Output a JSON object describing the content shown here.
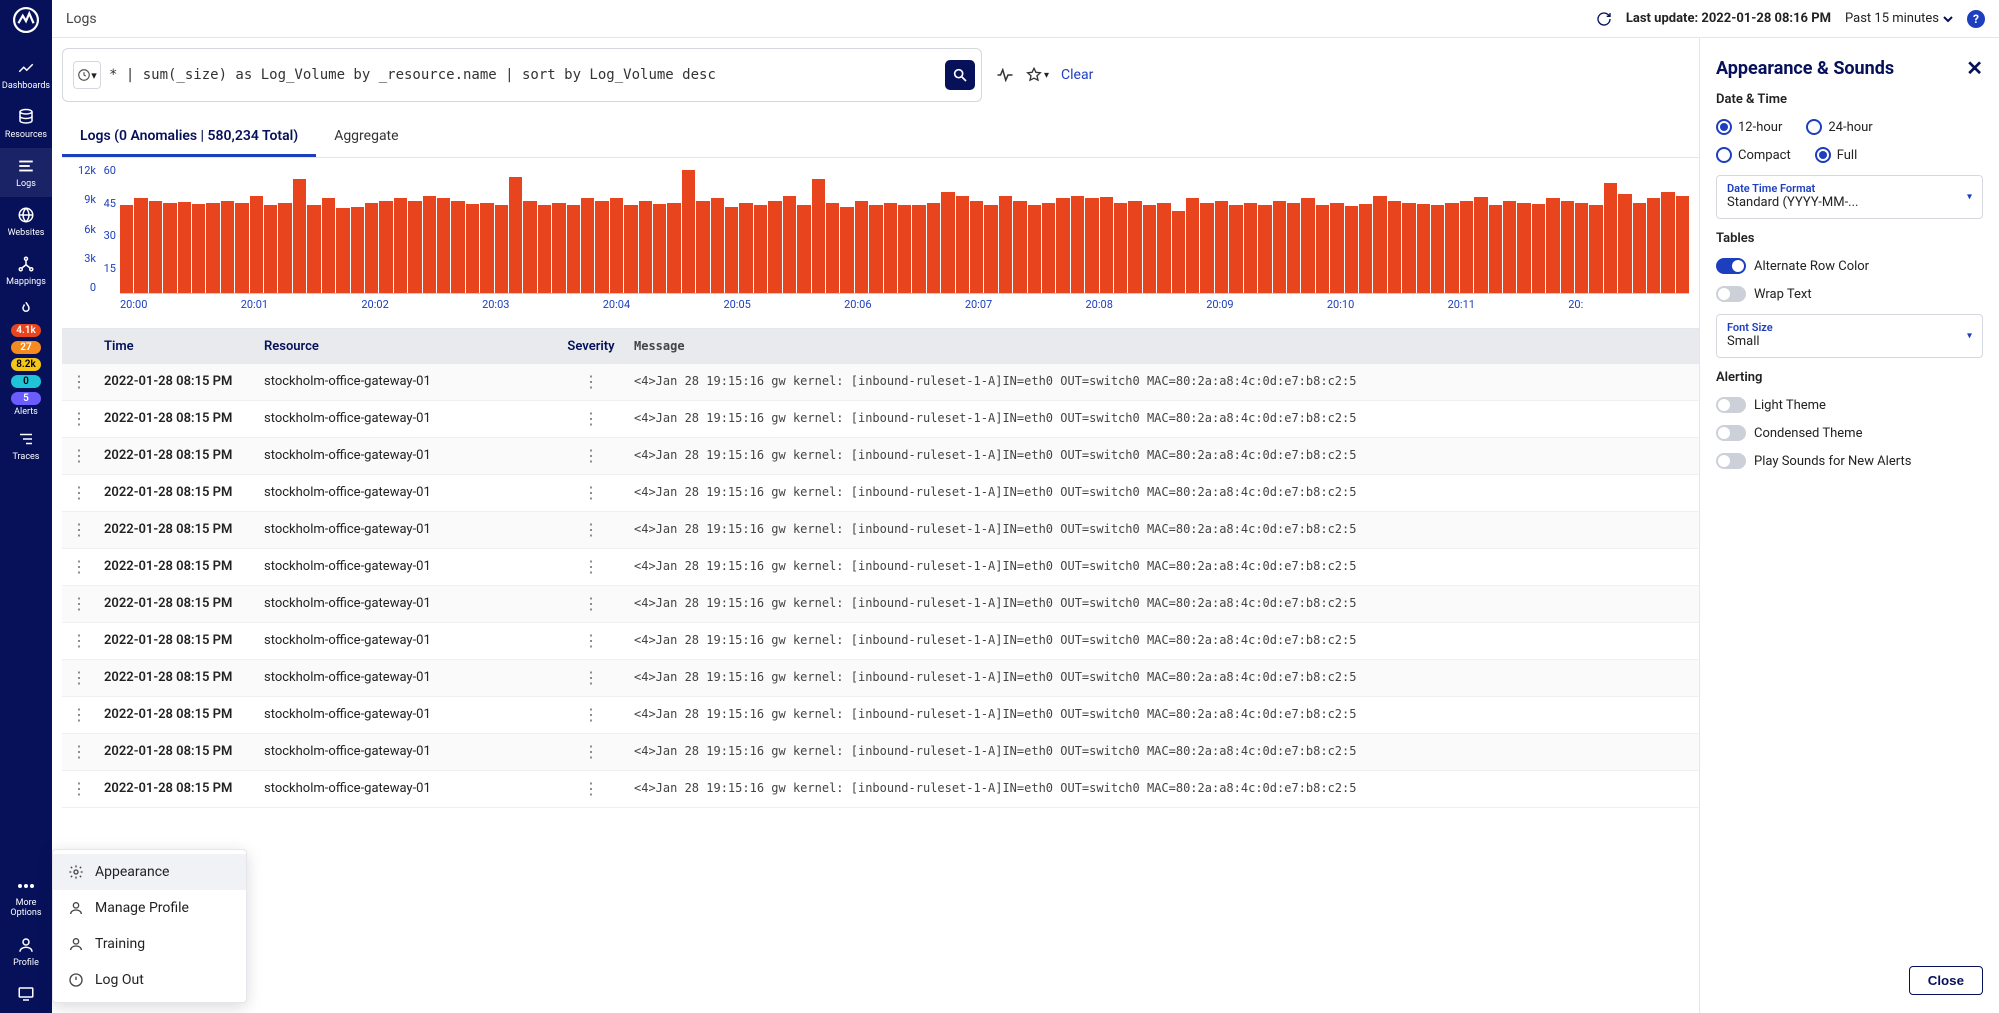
{
  "page_title": "Logs",
  "topbar": {
    "last_update_label": "Last update:",
    "last_update_value": "2022-01-28 08:16 PM",
    "time_range": "Past 15 minutes"
  },
  "sidebar": {
    "items": [
      {
        "label": "Dashboards"
      },
      {
        "label": "Resources"
      },
      {
        "label": "Logs"
      },
      {
        "label": "Websites"
      },
      {
        "label": "Mappings"
      }
    ],
    "alert_badges": [
      "4.1k",
      "27",
      "8.2k",
      "0",
      "5"
    ],
    "alerts_label": "Alerts",
    "traces_label": "Traces",
    "more_label": "More Options",
    "profile_label": "Profile"
  },
  "query": {
    "text": "* | sum(_size) as Log_Volume by _resource.name | sort by Log_Volume desc",
    "clear_label": "Clear"
  },
  "tabs": {
    "logs": "Logs (0 Anomalies | 580,234 Total)",
    "aggregate": "Aggregate"
  },
  "chart_data": {
    "type": "bar",
    "y_ticks_left": [
      "12k",
      "9k",
      "6k",
      "3k",
      "0"
    ],
    "y_ticks_right": [
      "60",
      "45",
      "30",
      "15",
      ""
    ],
    "x_ticks": [
      "20:00",
      "20:01",
      "20:02",
      "20:03",
      "20:04",
      "20:05",
      "20:06",
      "20:07",
      "20:08",
      "20:09",
      "20:10",
      "20:11",
      "20:"
    ],
    "ylim": [
      0,
      12000
    ],
    "values": [
      8.2,
      8.8,
      8.6,
      8.4,
      8.5,
      8.3,
      8.4,
      8.6,
      8.4,
      9.0,
      8.2,
      8.4,
      10.6,
      8.2,
      8.8,
      7.9,
      8.0,
      8.4,
      8.6,
      8.8,
      8.6,
      9.0,
      8.8,
      8.6,
      8.3,
      8.4,
      8.2,
      10.8,
      8.6,
      8.2,
      8.4,
      8.2,
      8.8,
      8.6,
      8.8,
      8.2,
      8.6,
      8.3,
      8.4,
      11.4,
      8.6,
      8.8,
      8.0,
      8.4,
      8.2,
      8.6,
      9.0,
      8.2,
      10.6,
      8.4,
      8.0,
      8.6,
      8.2,
      8.4,
      8.2,
      8.2,
      8.4,
      9.4,
      9.0,
      8.6,
      8.2,
      9.0,
      8.6,
      8.2,
      8.4,
      8.8,
      9.0,
      8.8,
      8.9,
      8.4,
      8.6,
      8.2,
      8.4,
      7.6,
      8.8,
      8.4,
      8.6,
      8.2,
      8.4,
      8.2,
      8.6,
      8.4,
      8.8,
      8.2,
      8.4,
      8.1,
      8.3,
      9.0,
      8.6,
      8.4,
      8.3,
      8.2,
      8.4,
      8.6,
      8.9,
      8.2,
      8.6,
      8.4,
      8.3,
      8.8,
      8.6,
      8.4,
      8.2,
      10.2,
      9.2,
      8.4,
      8.8,
      9.4,
      9.0
    ]
  },
  "table": {
    "headers": {
      "time": "Time",
      "resource": "Resource",
      "severity": "Severity",
      "message": "Message"
    },
    "rows": [
      {
        "time": "2022-01-28 08:15 PM",
        "resource": "stockholm-office-gateway-01",
        "message": "<4>Jan 28 19:15:16 gw kernel: [inbound-ruleset-1-A]IN=eth0 OUT=switch0 MAC=80:2a:a8:4c:0d:e7:b8:c2:5"
      },
      {
        "time": "2022-01-28 08:15 PM",
        "resource": "stockholm-office-gateway-01",
        "message": "<4>Jan 28 19:15:16 gw kernel: [inbound-ruleset-1-A]IN=eth0 OUT=switch0 MAC=80:2a:a8:4c:0d:e7:b8:c2:5"
      },
      {
        "time": "2022-01-28 08:15 PM",
        "resource": "stockholm-office-gateway-01",
        "message": "<4>Jan 28 19:15:16 gw kernel: [inbound-ruleset-1-A]IN=eth0 OUT=switch0 MAC=80:2a:a8:4c:0d:e7:b8:c2:5"
      },
      {
        "time": "2022-01-28 08:15 PM",
        "resource": "stockholm-office-gateway-01",
        "message": "<4>Jan 28 19:15:16 gw kernel: [inbound-ruleset-1-A]IN=eth0 OUT=switch0 MAC=80:2a:a8:4c:0d:e7:b8:c2:5"
      },
      {
        "time": "2022-01-28 08:15 PM",
        "resource": "stockholm-office-gateway-01",
        "message": "<4>Jan 28 19:15:16 gw kernel: [inbound-ruleset-1-A]IN=eth0 OUT=switch0 MAC=80:2a:a8:4c:0d:e7:b8:c2:5"
      },
      {
        "time": "2022-01-28 08:15 PM",
        "resource": "stockholm-office-gateway-01",
        "message": "<4>Jan 28 19:15:16 gw kernel: [inbound-ruleset-1-A]IN=eth0 OUT=switch0 MAC=80:2a:a8:4c:0d:e7:b8:c2:5"
      },
      {
        "time": "2022-01-28 08:15 PM",
        "resource": "stockholm-office-gateway-01",
        "message": "<4>Jan 28 19:15:16 gw kernel: [inbound-ruleset-1-A]IN=eth0 OUT=switch0 MAC=80:2a:a8:4c:0d:e7:b8:c2:5"
      },
      {
        "time": "2022-01-28 08:15 PM",
        "resource": "stockholm-office-gateway-01",
        "message": "<4>Jan 28 19:15:16 gw kernel: [inbound-ruleset-1-A]IN=eth0 OUT=switch0 MAC=80:2a:a8:4c:0d:e7:b8:c2:5"
      },
      {
        "time": "2022-01-28 08:15 PM",
        "resource": "stockholm-office-gateway-01",
        "message": "<4>Jan 28 19:15:16 gw kernel: [inbound-ruleset-1-A]IN=eth0 OUT=switch0 MAC=80:2a:a8:4c:0d:e7:b8:c2:5"
      },
      {
        "time": "2022-01-28 08:15 PM",
        "resource": "stockholm-office-gateway-01",
        "message": "<4>Jan 28 19:15:16 gw kernel: [inbound-ruleset-1-A]IN=eth0 OUT=switch0 MAC=80:2a:a8:4c:0d:e7:b8:c2:5"
      },
      {
        "time": "2022-01-28 08:15 PM",
        "resource": "stockholm-office-gateway-01",
        "message": "<4>Jan 28 19:15:16 gw kernel: [inbound-ruleset-1-A]IN=eth0 OUT=switch0 MAC=80:2a:a8:4c:0d:e7:b8:c2:5"
      },
      {
        "time": "2022-01-28 08:15 PM",
        "resource": "stockholm-office-gateway-01",
        "message": "<4>Jan 28 19:15:16 gw kernel: [inbound-ruleset-1-A]IN=eth0 OUT=switch0 MAC=80:2a:a8:4c:0d:e7:b8:c2:5"
      }
    ]
  },
  "panel": {
    "title": "Appearance & Sounds",
    "date_time_label": "Date & Time",
    "opt_12h": "12-hour",
    "opt_24h": "24-hour",
    "opt_compact": "Compact",
    "opt_full": "Full",
    "date_format_label": "Date Time Format",
    "date_format_value": "Standard (YYYY-MM-...",
    "tables_label": "Tables",
    "toggle_alt_row": "Alternate Row Color",
    "toggle_wrap": "Wrap Text",
    "font_size_label": "Font Size",
    "font_size_value": "Small",
    "alerting_label": "Alerting",
    "toggle_light": "Light Theme",
    "toggle_condensed": "Condensed Theme",
    "toggle_sounds": "Play Sounds for New Alerts",
    "close_label": "Close"
  },
  "profile_menu": {
    "appearance": "Appearance",
    "manage": "Manage Profile",
    "training": "Training",
    "logout": "Log Out"
  }
}
